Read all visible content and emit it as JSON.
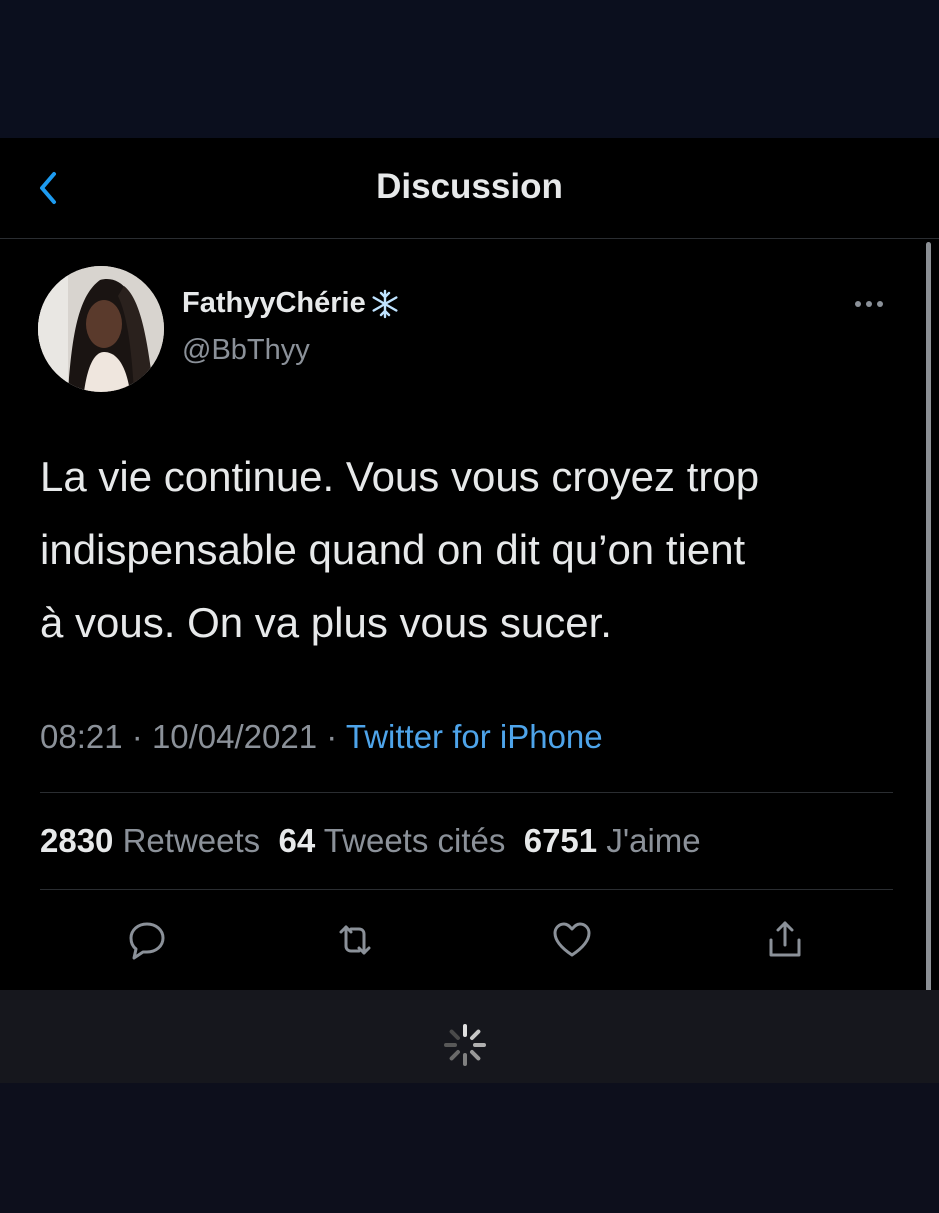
{
  "header": {
    "title": "Discussion"
  },
  "tweet": {
    "display_name": "FathyyChérie",
    "handle": "@BbThyy",
    "text": "La vie continue. Vous vous croyez trop\nindispensable quand on dit qu’on tient\nà vous. On va plus vous sucer.",
    "time": "08:21",
    "date": "10/04/2021",
    "separator": "·",
    "source": "Twitter for iPhone"
  },
  "stats": {
    "retweets_count": "2830",
    "retweets_label": "Retweets",
    "quotes_count": "64",
    "quotes_label": "Tweets cités",
    "likes_count": "6751",
    "likes_label": "J'aime"
  },
  "icons": {
    "back": "chevron-left-icon",
    "name_badge": "snowflake-icon",
    "more": "more-horizontal-icon",
    "reply": "reply-icon",
    "retweet": "retweet-icon",
    "like": "heart-icon",
    "share": "share-icon",
    "loading": "spinner-icon"
  },
  "colors": {
    "background": "#000000",
    "accent": "#1d9bf0",
    "link": "#4ea4ea",
    "secondary_text": "#8b9199",
    "primary_text": "#e7e9ea"
  }
}
